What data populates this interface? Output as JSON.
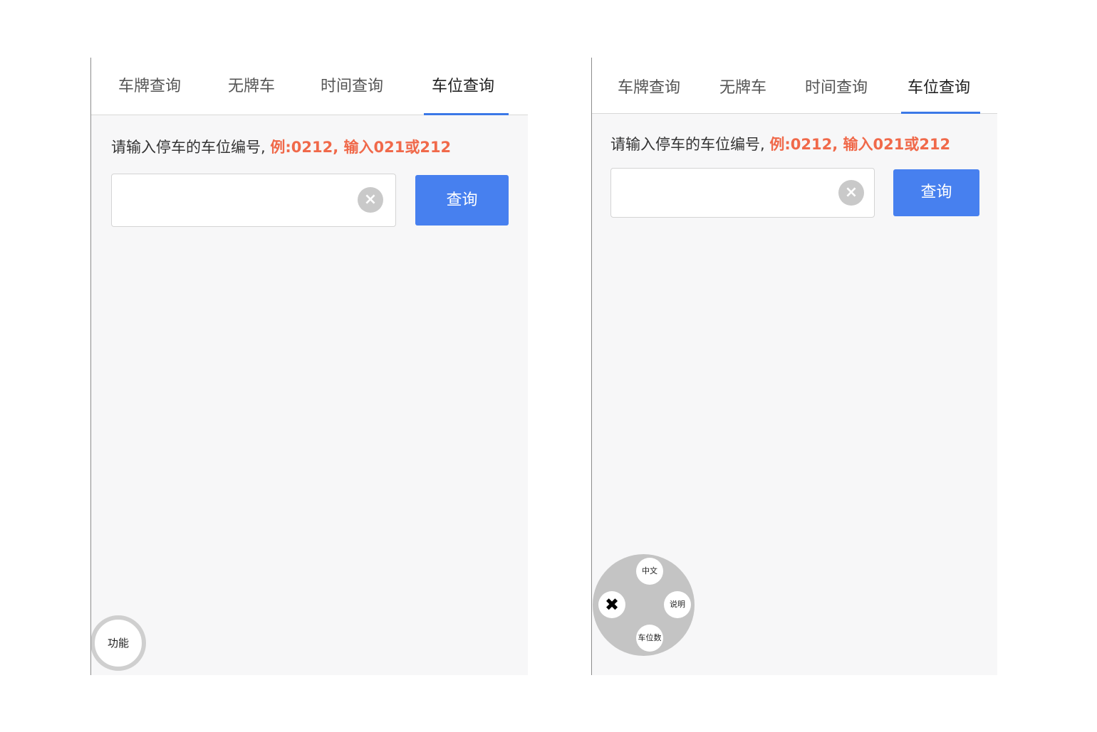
{
  "screens": [
    {
      "tabs": [
        {
          "label": "车牌查询"
        },
        {
          "label": "无牌车"
        },
        {
          "label": "时间查询"
        },
        {
          "label": "车位查询"
        }
      ],
      "active_tab": "车位查询",
      "hint": {
        "text": "请输入停车的车位编号, ",
        "example": "例:0212, 输入021或212"
      },
      "input": {
        "value": "",
        "placeholder": ""
      },
      "clear_icon": "×",
      "search_button": "查询",
      "fab_label": "功能"
    },
    {
      "tabs": [
        {
          "label": "车牌查询"
        },
        {
          "label": "无牌车"
        },
        {
          "label": "时间查询"
        },
        {
          "label": "车位查询"
        }
      ],
      "active_tab": "车位查询",
      "hint": {
        "text": "请输入停车的车位编号, ",
        "example": "例:0212, 输入021或212"
      },
      "input": {
        "value": "",
        "placeholder": ""
      },
      "clear_icon": "×",
      "search_button": "查询",
      "menu": {
        "close_icon": "✖",
        "items": [
          "中文",
          "说明",
          "车位数"
        ]
      }
    }
  ],
  "colors": {
    "accent": "#4780ef",
    "tab_underline": "#3b78e7",
    "example_text": "#f0694a",
    "background": "#f7f7f8"
  }
}
